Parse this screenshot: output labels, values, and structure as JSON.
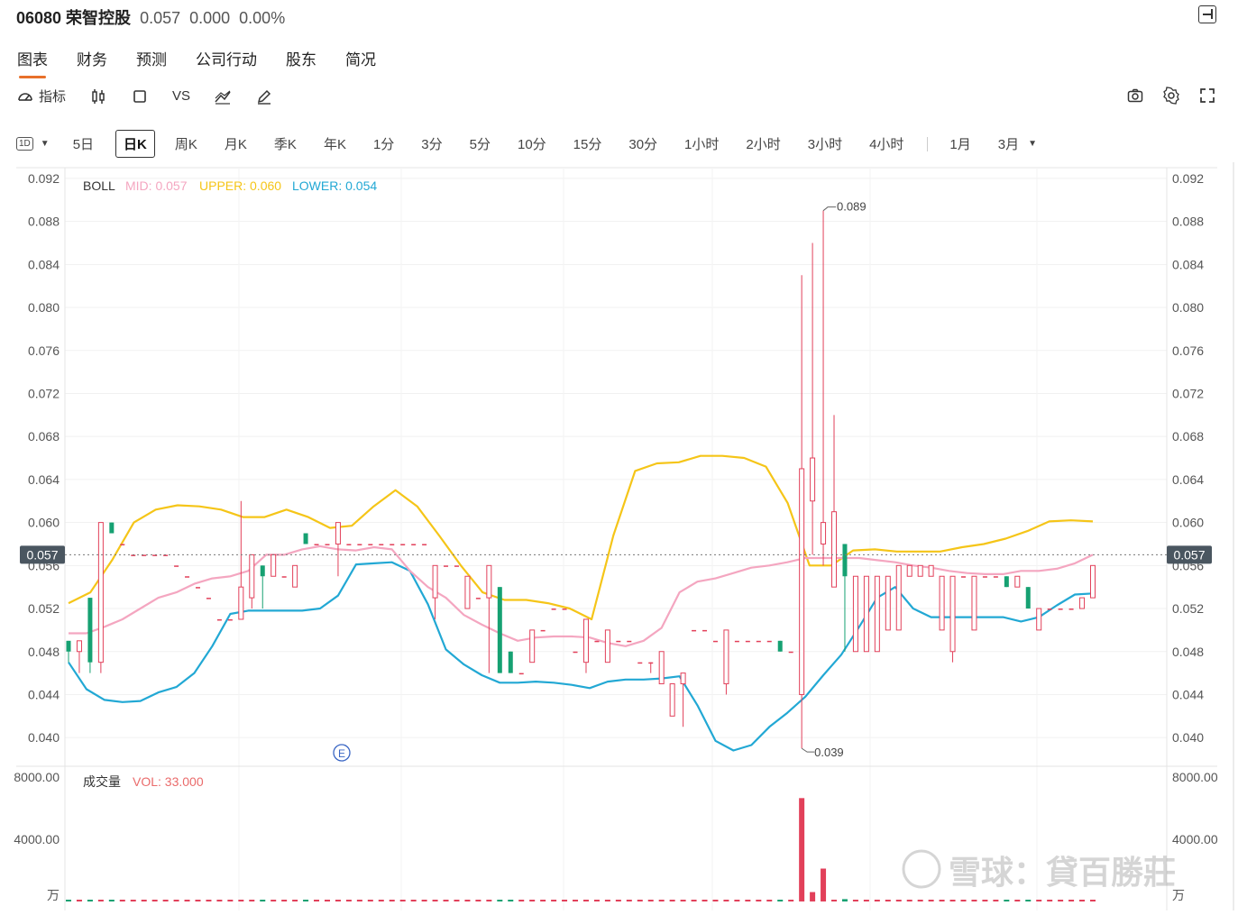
{
  "header": {
    "code_name": "06080 荣智控股",
    "price": "0.057",
    "change": "0.000",
    "change_pct": "0.00%"
  },
  "tabs": [
    {
      "label": "图表",
      "active": true
    },
    {
      "label": "财务",
      "active": false
    },
    {
      "label": "预测",
      "active": false
    },
    {
      "label": "公司行动",
      "active": false
    },
    {
      "label": "股东",
      "active": false
    },
    {
      "label": "简况",
      "active": false
    }
  ],
  "toolbar": {
    "indicator_label": "指标",
    "vs_label": "VS"
  },
  "periods": {
    "interval_badge": "1D",
    "items": [
      "5日",
      "日K",
      "周K",
      "月K",
      "季K",
      "年K",
      "1分",
      "3分",
      "5分",
      "10分",
      "15分",
      "30分",
      "1小时",
      "2小时",
      "3小时",
      "4小时"
    ],
    "active": "日K",
    "range_items": [
      "1月",
      "3月"
    ]
  },
  "indicator": {
    "name": "BOLL",
    "mid_label": "MID: 0.057",
    "upper_label": "UPPER: 0.060",
    "lower_label": "LOWER: 0.054",
    "mid_color": "#f4a6c0",
    "upper_color": "#f5c518",
    "lower_color": "#22a8d4"
  },
  "volume_panel": {
    "name": "成交量",
    "vol_label": "VOL: 33.000",
    "y_ticks": [
      "8000.00",
      "4000.00"
    ],
    "unit": "万"
  },
  "price_axis": {
    "ticks": [
      "0.092",
      "0.088",
      "0.084",
      "0.080",
      "0.076",
      "0.072",
      "0.068",
      "0.064",
      "0.060",
      "0.056",
      "0.052",
      "0.048",
      "0.044",
      "0.040"
    ],
    "last_price_label": "0.057",
    "high_label": "0.089",
    "low_label": "0.039"
  },
  "event_marker": "E",
  "watermark": "雪球：貸百勝莊",
  "chart_data": {
    "type": "candlestick",
    "y_range": [
      0.0375,
      0.0935
    ],
    "volume_range": [
      0,
      8000
    ],
    "last_price": 0.057,
    "count": 96,
    "candles": [
      [
        0.049,
        0.048,
        0.049,
        0.047
      ],
      [
        0.048,
        0.049,
        0.049,
        0.046
      ],
      [
        0.053,
        0.047,
        0.053,
        0.046
      ],
      [
        0.047,
        0.06,
        0.06,
        0.046
      ],
      [
        0.06,
        0.059,
        0.06,
        0.059
      ],
      [
        0.058,
        0.058,
        0.058,
        0.058
      ],
      [
        0.057,
        0.057,
        0.057,
        0.057
      ],
      [
        0.057,
        0.057,
        0.057,
        0.057
      ],
      [
        0.057,
        0.057,
        0.057,
        0.057
      ],
      [
        0.057,
        0.057,
        0.057,
        0.057
      ],
      [
        0.056,
        0.056,
        0.056,
        0.056
      ],
      [
        0.055,
        0.055,
        0.055,
        0.055
      ],
      [
        0.054,
        0.054,
        0.054,
        0.054
      ],
      [
        0.053,
        0.053,
        0.053,
        0.053
      ],
      [
        0.051,
        0.051,
        0.051,
        0.051
      ],
      [
        0.051,
        0.051,
        0.051,
        0.051
      ],
      [
        0.051,
        0.054,
        0.062,
        0.051
      ],
      [
        0.053,
        0.057,
        0.057,
        0.052
      ],
      [
        0.056,
        0.055,
        0.056,
        0.052
      ],
      [
        0.055,
        0.057,
        0.057,
        0.055
      ],
      [
        0.055,
        0.055,
        0.055,
        0.055
      ],
      [
        0.054,
        0.056,
        0.056,
        0.054
      ],
      [
        0.059,
        0.058,
        0.059,
        0.058
      ],
      [
        0.058,
        0.058,
        0.058,
        0.058
      ],
      [
        0.058,
        0.058,
        0.058,
        0.058
      ],
      [
        0.058,
        0.06,
        0.06,
        0.055
      ],
      [
        0.058,
        0.058,
        0.058,
        0.058
      ],
      [
        0.058,
        0.058,
        0.058,
        0.058
      ],
      [
        0.058,
        0.058,
        0.058,
        0.058
      ],
      [
        0.058,
        0.058,
        0.058,
        0.058
      ],
      [
        0.058,
        0.058,
        0.058,
        0.058
      ],
      [
        0.058,
        0.058,
        0.058,
        0.058
      ],
      [
        0.058,
        0.058,
        0.058,
        0.058
      ],
      [
        0.058,
        0.058,
        0.058,
        0.058
      ],
      [
        0.053,
        0.056,
        0.056,
        0.051
      ],
      [
        0.056,
        0.056,
        0.056,
        0.056
      ],
      [
        0.056,
        0.056,
        0.056,
        0.056
      ],
      [
        0.052,
        0.055,
        0.055,
        0.052
      ],
      [
        0.053,
        0.053,
        0.053,
        0.053
      ],
      [
        0.053,
        0.056,
        0.056,
        0.046
      ],
      [
        0.054,
        0.046,
        0.054,
        0.046
      ],
      [
        0.048,
        0.046,
        0.048,
        0.046
      ],
      [
        0.046,
        0.046,
        0.046,
        0.046
      ],
      [
        0.047,
        0.05,
        0.05,
        0.047
      ],
      [
        0.05,
        0.05,
        0.05,
        0.05
      ],
      [
        0.052,
        0.052,
        0.052,
        0.052
      ],
      [
        0.052,
        0.052,
        0.052,
        0.052
      ],
      [
        0.048,
        0.048,
        0.048,
        0.048
      ],
      [
        0.047,
        0.051,
        0.051,
        0.046
      ],
      [
        0.049,
        0.049,
        0.049,
        0.049
      ],
      [
        0.047,
        0.05,
        0.05,
        0.047
      ],
      [
        0.049,
        0.049,
        0.049,
        0.049
      ],
      [
        0.049,
        0.049,
        0.049,
        0.049
      ],
      [
        0.047,
        0.047,
        0.047,
        0.047
      ],
      [
        0.047,
        0.047,
        0.047,
        0.046
      ],
      [
        0.045,
        0.048,
        0.048,
        0.045
      ],
      [
        0.042,
        0.045,
        0.045,
        0.042
      ],
      [
        0.045,
        0.046,
        0.046,
        0.041
      ],
      [
        0.05,
        0.05,
        0.05,
        0.05
      ],
      [
        0.05,
        0.05,
        0.05,
        0.05
      ],
      [
        0.049,
        0.049,
        0.049,
        0.049
      ],
      [
        0.045,
        0.05,
        0.05,
        0.044
      ],
      [
        0.049,
        0.049,
        0.049,
        0.049
      ],
      [
        0.049,
        0.049,
        0.049,
        0.049
      ],
      [
        0.049,
        0.049,
        0.049,
        0.049
      ],
      [
        0.049,
        0.049,
        0.049,
        0.049
      ],
      [
        0.049,
        0.048,
        0.049,
        0.048
      ],
      [
        0.048,
        0.048,
        0.048,
        0.048
      ],
      [
        0.044,
        0.065,
        0.083,
        0.039
      ],
      [
        0.062,
        0.066,
        0.086,
        0.057
      ],
      [
        0.058,
        0.06,
        0.089,
        0.056
      ],
      [
        0.054,
        0.061,
        0.07,
        0.054
      ],
      [
        0.058,
        0.055,
        0.058,
        0.048
      ],
      [
        0.048,
        0.055,
        0.055,
        0.048
      ],
      [
        0.048,
        0.055,
        0.055,
        0.048
      ],
      [
        0.048,
        0.055,
        0.055,
        0.048
      ],
      [
        0.05,
        0.055,
        0.055,
        0.05
      ],
      [
        0.05,
        0.056,
        0.056,
        0.05
      ],
      [
        0.055,
        0.056,
        0.056,
        0.055
      ],
      [
        0.055,
        0.056,
        0.056,
        0.055
      ],
      [
        0.055,
        0.056,
        0.056,
        0.055
      ],
      [
        0.05,
        0.055,
        0.055,
        0.05
      ],
      [
        0.048,
        0.055,
        0.055,
        0.047
      ],
      [
        0.055,
        0.055,
        0.055,
        0.055
      ],
      [
        0.05,
        0.055,
        0.055,
        0.05
      ],
      [
        0.055,
        0.055,
        0.055,
        0.055
      ],
      [
        0.055,
        0.055,
        0.055,
        0.055
      ],
      [
        0.055,
        0.054,
        0.055,
        0.054
      ],
      [
        0.054,
        0.055,
        0.055,
        0.054
      ],
      [
        0.054,
        0.052,
        0.054,
        0.052
      ],
      [
        0.05,
        0.052,
        0.052,
        0.05
      ],
      [
        0.052,
        0.052,
        0.052,
        0.052
      ],
      [
        0.052,
        0.052,
        0.052,
        0.052
      ],
      [
        0.052,
        0.052,
        0.052,
        0.052
      ],
      [
        0.052,
        0.053,
        0.053,
        0.052
      ],
      [
        0.053,
        0.056,
        0.056,
        0.053
      ]
    ],
    "volumes": [
      20,
      10,
      10,
      60,
      20,
      0,
      0,
      0,
      0,
      0,
      0,
      0,
      0,
      0,
      10,
      10,
      50,
      20,
      10,
      10,
      20,
      10,
      0,
      20,
      10,
      20,
      0,
      0,
      0,
      0,
      0,
      0,
      0,
      0,
      10,
      0,
      0,
      0,
      0,
      80,
      30,
      60,
      40,
      20,
      10,
      20,
      10,
      20,
      0,
      10,
      40,
      0,
      10,
      0,
      20,
      0,
      10,
      10,
      10,
      10,
      10,
      20,
      0,
      0,
      0,
      0,
      0,
      0,
      6600,
      600,
      2100,
      60,
      150,
      20,
      10,
      10,
      10,
      10,
      0,
      10,
      10,
      0,
      20,
      10,
      10,
      0,
      20,
      20,
      0,
      10,
      30,
      10,
      20,
      10,
      10,
      10
    ],
    "mid": [
      0.0497,
      0.0497,
      0.0503,
      0.051,
      0.052,
      0.053,
      0.0535,
      0.0543,
      0.0548,
      0.055,
      0.0555,
      0.057,
      0.057,
      0.0575,
      0.0578,
      0.0575,
      0.0574,
      0.0577,
      0.0575,
      0.0555,
      0.054,
      0.053,
      0.0514,
      0.0505,
      0.0497,
      0.049,
      0.0493,
      0.0494,
      0.0494,
      0.0493,
      0.0488,
      0.0485,
      0.049,
      0.0502,
      0.0535,
      0.0545,
      0.0548,
      0.0553,
      0.0558,
      0.056,
      0.0563,
      0.0567,
      0.0567,
      0.0567,
      0.0567,
      0.0565,
      0.0563,
      0.056,
      0.0558,
      0.0555,
      0.0553,
      0.0552,
      0.0552,
      0.0555,
      0.0555,
      0.0557,
      0.0562,
      0.057
    ],
    "upper": [
      0.0525,
      0.0535,
      0.0565,
      0.06,
      0.0612,
      0.0616,
      0.0615,
      0.0612,
      0.0605,
      0.0605,
      0.0612,
      0.0605,
      0.0595,
      0.0597,
      0.0615,
      0.063,
      0.0615,
      0.0588,
      0.056,
      0.0535,
      0.0528,
      0.0528,
      0.0525,
      0.052,
      0.051,
      0.0588,
      0.0648,
      0.0655,
      0.0656,
      0.0662,
      0.0662,
      0.066,
      0.0652,
      0.0618,
      0.056,
      0.056,
      0.0574,
      0.0575,
      0.0573,
      0.0573,
      0.0573,
      0.0577,
      0.058,
      0.0585,
      0.0592,
      0.0601,
      0.0602,
      0.0601
    ],
    "lower": [
      0.047,
      0.0445,
      0.0435,
      0.0433,
      0.0434,
      0.0442,
      0.0447,
      0.046,
      0.0485,
      0.0515,
      0.0518,
      0.0518,
      0.0518,
      0.0518,
      0.052,
      0.0532,
      0.0561,
      0.0562,
      0.0563,
      0.0555,
      0.0524,
      0.0482,
      0.0468,
      0.0458,
      0.0451,
      0.0451,
      0.0452,
      0.0451,
      0.0449,
      0.0446,
      0.0452,
      0.0454,
      0.0454,
      0.0455,
      0.0457,
      0.043,
      0.0397,
      0.0388,
      0.0393,
      0.041,
      0.0423,
      0.0438,
      0.0458,
      0.0477,
      0.0503,
      0.053,
      0.054,
      0.052,
      0.0512,
      0.0512,
      0.0512,
      0.0512,
      0.0512,
      0.0508,
      0.0512,
      0.0523,
      0.0533,
      0.0534
    ]
  }
}
